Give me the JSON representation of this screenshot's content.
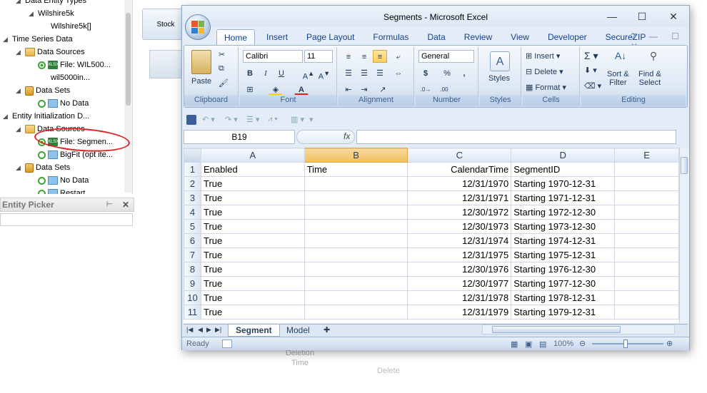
{
  "tree": {
    "nodes": [
      {
        "label": "Data Entity Types",
        "icon": "none",
        "indent": 2
      },
      {
        "label": "Wilshire5k",
        "icon": "none",
        "indent": 3
      },
      {
        "label": "Wilshire5k[]",
        "icon": "none",
        "indent": 4
      },
      {
        "label": "Time Series Data",
        "icon": "none",
        "indent": 1
      },
      {
        "label": "Data Sources",
        "icon": "folder",
        "indent": 2
      },
      {
        "label": "File: WIL500...",
        "icon": "xls",
        "indent": 3
      },
      {
        "label": "wil5000in...",
        "icon": "none",
        "indent": 4
      },
      {
        "label": "Data Sets",
        "icon": "db",
        "indent": 2
      },
      {
        "label": "No Data",
        "icon": "sheet",
        "indent": 3
      },
      {
        "label": "Entity Initialization D...",
        "icon": "none",
        "indent": 1
      },
      {
        "label": "Data Sources",
        "icon": "folder",
        "indent": 2
      },
      {
        "label": "File: Segmen...",
        "icon": "xls",
        "indent": 3
      },
      {
        "label": "BigFit (opt ite...",
        "icon": "sheet",
        "indent": 3
      },
      {
        "label": "Data Sets",
        "icon": "db",
        "indent": 2
      },
      {
        "label": "No Data",
        "icon": "sheet",
        "indent": 3
      },
      {
        "label": "Restart",
        "icon": "sheet",
        "indent": 3
      }
    ]
  },
  "entity_picker": {
    "title": "Entity Picker",
    "pin": "📌",
    "close": "✕"
  },
  "background_app": {
    "stock_button": "Stock",
    "deletion_label": "Deletion\nTime",
    "faded_text": "Delete"
  },
  "excel": {
    "title": "Segments - Microsoft Excel",
    "window_controls": {
      "minimize": "—",
      "maximize": "☐",
      "close": "✕"
    },
    "tabs": [
      "Home",
      "Insert",
      "Page Layout",
      "Formulas",
      "Data",
      "Review",
      "View",
      "Developer",
      "SecureZIP"
    ],
    "active_tab": "Home",
    "ribbon": {
      "clipboard": {
        "label": "Clipboard",
        "paste": "Paste"
      },
      "font": {
        "label": "Font",
        "family": "Calibri",
        "size": "11"
      },
      "alignment": {
        "label": "Alignment"
      },
      "number": {
        "label": "Number",
        "format": "General"
      },
      "styles": {
        "label": "Styles"
      },
      "cells": {
        "label": "Cells",
        "insert": "Insert",
        "delete": "Delete",
        "format": "Format"
      },
      "editing": {
        "label": "Editing",
        "sort": "Sort &\nFilter",
        "find": "Find &\nSelect"
      }
    },
    "name_box": "B19",
    "fx": "fx",
    "columns": [
      "A",
      "B",
      "C",
      "D",
      "E"
    ],
    "selected_column": "B",
    "rows": [
      {
        "n": "1",
        "a": "Enabled",
        "b": "Time",
        "c": "CalendarTime",
        "d": "SegmentID"
      },
      {
        "n": "2",
        "a": "True",
        "b": "",
        "c": "12/31/1970",
        "d": "Starting 1970-12-31"
      },
      {
        "n": "3",
        "a": "True",
        "b": "",
        "c": "12/31/1971",
        "d": "Starting 1971-12-31"
      },
      {
        "n": "4",
        "a": "True",
        "b": "",
        "c": "12/30/1972",
        "d": "Starting 1972-12-30"
      },
      {
        "n": "5",
        "a": "True",
        "b": "",
        "c": "12/30/1973",
        "d": "Starting 1973-12-30"
      },
      {
        "n": "6",
        "a": "True",
        "b": "",
        "c": "12/31/1974",
        "d": "Starting 1974-12-31"
      },
      {
        "n": "7",
        "a": "True",
        "b": "",
        "c": "12/31/1975",
        "d": "Starting 1975-12-31"
      },
      {
        "n": "8",
        "a": "True",
        "b": "",
        "c": "12/30/1976",
        "d": "Starting 1976-12-30"
      },
      {
        "n": "9",
        "a": "True",
        "b": "",
        "c": "12/30/1977",
        "d": "Starting 1977-12-30"
      },
      {
        "n": "10",
        "a": "True",
        "b": "",
        "c": "12/31/1978",
        "d": "Starting 1978-12-31"
      },
      {
        "n": "11",
        "a": "True",
        "b": "",
        "c": "12/31/1979",
        "d": "Starting 1979-12-31"
      }
    ],
    "sheet_tabs": [
      "Segment",
      "Model"
    ],
    "active_sheet": "Segment",
    "status": "Ready",
    "zoom": "100%"
  },
  "colors": {
    "highlight_ellipse": "#d22222",
    "excel_accent": "#15428b",
    "selected_header": "#f1c05d"
  }
}
